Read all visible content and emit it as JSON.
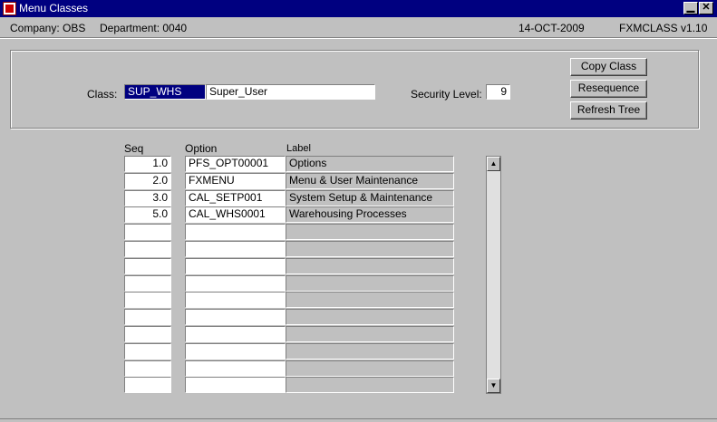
{
  "window": {
    "title": "Menu Classes",
    "minimize_glyph": "▁",
    "close_glyph": "✕",
    "icon": "oracle-forms-app-icon"
  },
  "infobar": {
    "company": "Company: OBS",
    "department": "Department: 0040",
    "date": "14-OCT-2009",
    "form_id": "FXMCLASS v1.10"
  },
  "header": {
    "class_label": "Class:",
    "class_code": "SUP_WHS",
    "class_name": "Super_User",
    "security_label": "Security Level:",
    "security_level": "9"
  },
  "buttons": {
    "copy_class": "Copy Class",
    "resequence": "Resequence",
    "refresh_tree": "Refresh Tree"
  },
  "table": {
    "headers": {
      "seq": "Seq",
      "option": "Option",
      "label": "Label"
    },
    "rows": [
      {
        "seq": "1.0",
        "option": "PFS_OPT00001",
        "label": "Options"
      },
      {
        "seq": "2.0",
        "option": "FXMENU",
        "label": "Menu & User Maintenance"
      },
      {
        "seq": "3.0",
        "option": "CAL_SETP001",
        "label": "System Setup & Maintenance"
      },
      {
        "seq": "5.0",
        "option": "CAL_WHS0001",
        "label": "Warehousing Processes"
      },
      {
        "seq": "",
        "option": "",
        "label": ""
      },
      {
        "seq": "",
        "option": "",
        "label": ""
      },
      {
        "seq": "",
        "option": "",
        "label": ""
      },
      {
        "seq": "",
        "option": "",
        "label": ""
      },
      {
        "seq": "",
        "option": "",
        "label": ""
      },
      {
        "seq": "",
        "option": "",
        "label": ""
      },
      {
        "seq": "",
        "option": "",
        "label": ""
      },
      {
        "seq": "",
        "option": "",
        "label": ""
      },
      {
        "seq": "",
        "option": "",
        "label": ""
      },
      {
        "seq": "",
        "option": "",
        "label": ""
      }
    ]
  },
  "scrollbar": {
    "up_glyph": "▲",
    "down_glyph": "▼"
  },
  "colors": {
    "titlebar": "#000080",
    "face": "#c0c0c0",
    "selection": "#000080"
  }
}
